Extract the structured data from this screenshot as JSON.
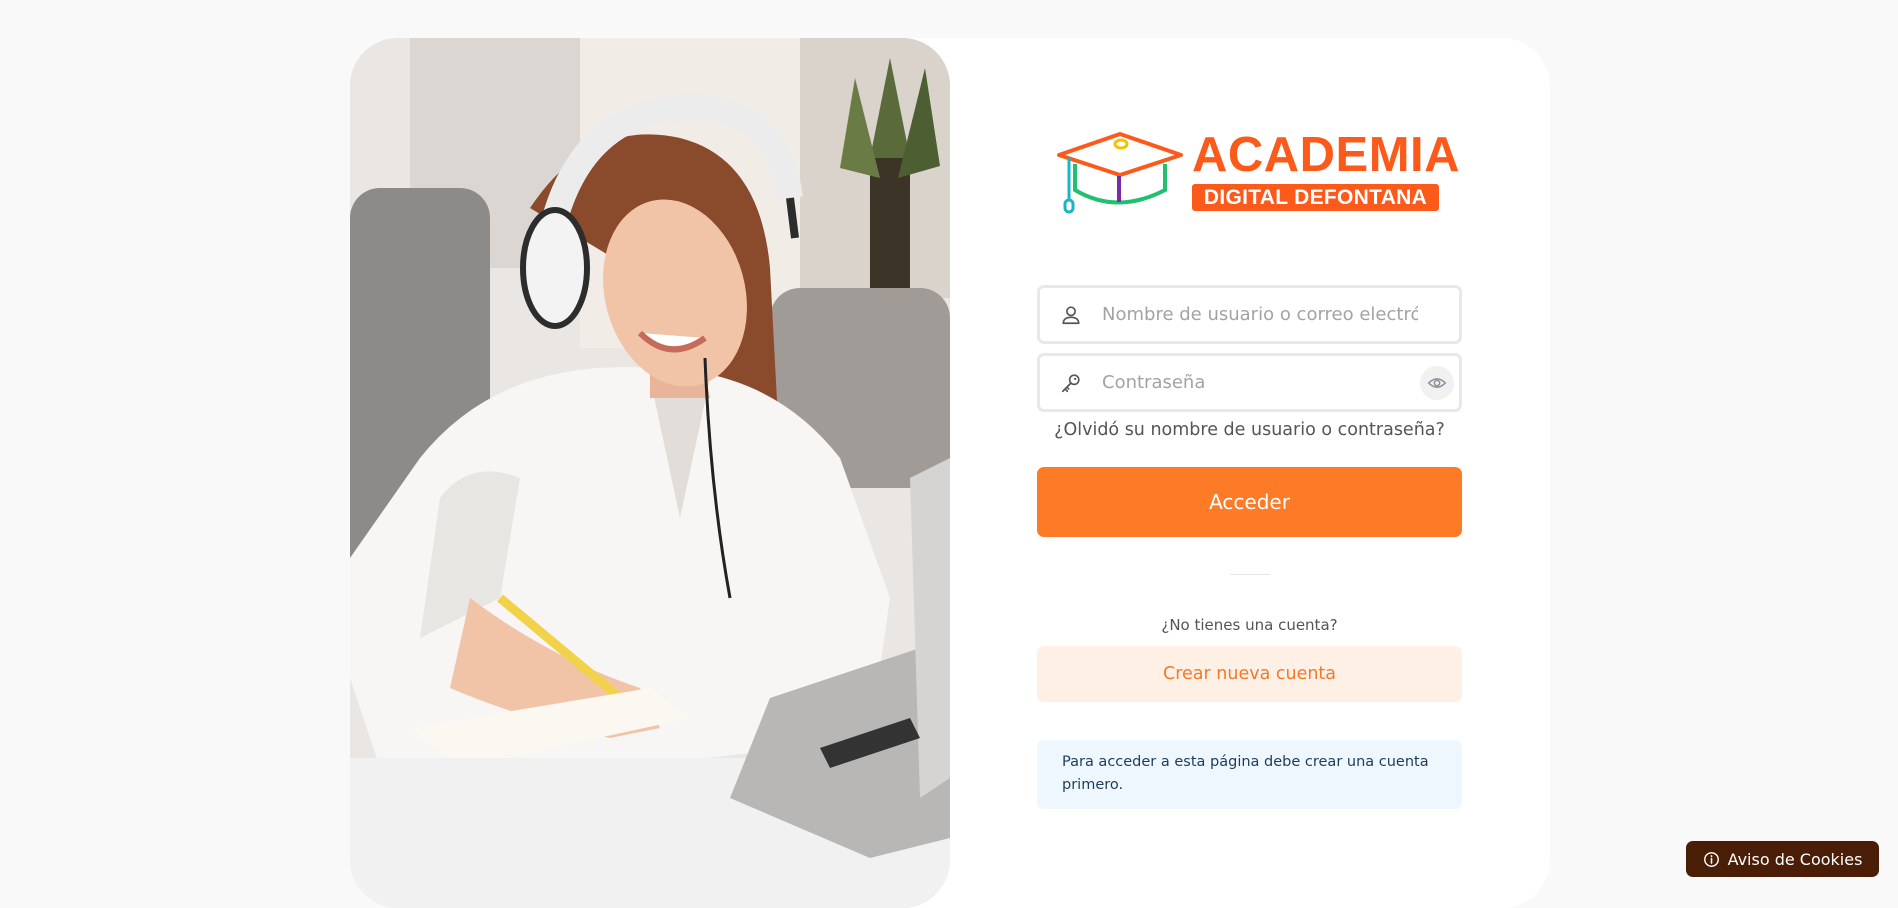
{
  "brand": {
    "name": "ACADEMIA",
    "subtitle": "DIGITAL DEFONTANA",
    "logo_icon": "graduation-cap-icon",
    "brand_color": "#fb5a1b"
  },
  "login_form": {
    "username_placeholder": "Nombre de usuario o correo electrónico",
    "username_value": "",
    "username_icon": "user-icon",
    "password_placeholder": "Contraseña",
    "password_value": "",
    "password_icon": "key-icon",
    "toggle_visibility_icon": "eye-icon",
    "forgot_link": "¿Olvidó su nombre de usuario o contraseña?",
    "submit_label": "Acceder",
    "accent_color": "#fd7a26"
  },
  "signup": {
    "prompt": "¿No tienes una cuenta?",
    "create_label": "Crear nueva cuenta"
  },
  "notice": {
    "text": "Para acceder a esta página debe crear una cuenta primero."
  },
  "cookies": {
    "label": "Aviso de Cookies",
    "icon": "info-circle-icon",
    "color": "#4a1d07"
  }
}
